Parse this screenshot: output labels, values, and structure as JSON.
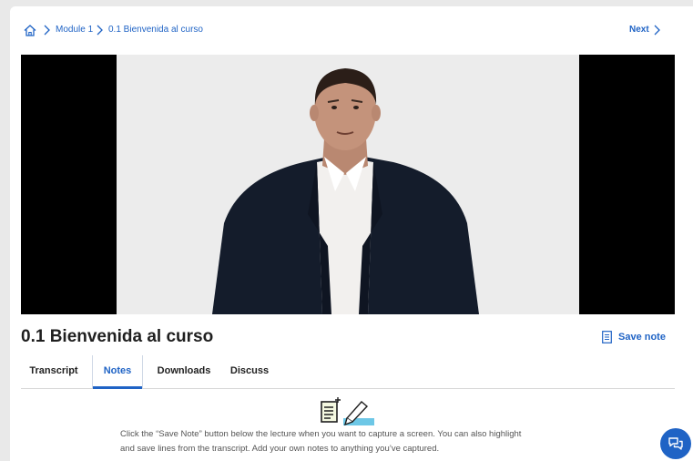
{
  "breadcrumb": {
    "home_icon": "home-icon",
    "module_label": "Module 1",
    "lesson_label": "0.1 Bienvenida al curso"
  },
  "nav": {
    "next_label": "Next"
  },
  "lecture": {
    "title": "0.1 Bienvenida al curso"
  },
  "actions": {
    "save_note_label": "Save note"
  },
  "tabs": [
    {
      "label": "Transcript",
      "active": false
    },
    {
      "label": "Notes",
      "active": true
    },
    {
      "label": "Downloads",
      "active": false
    },
    {
      "label": "Discuss",
      "active": false
    }
  ],
  "notes": {
    "line1": "Click the “Save Note” button below the lecture when you want to capture a screen. You can also highlight",
    "line2": "and save lines from the transcript. Add your own notes to anything you’ve captured."
  },
  "colors": {
    "accent": "#1f63c5",
    "text": "#1f1f1f",
    "muted": "#555555"
  }
}
